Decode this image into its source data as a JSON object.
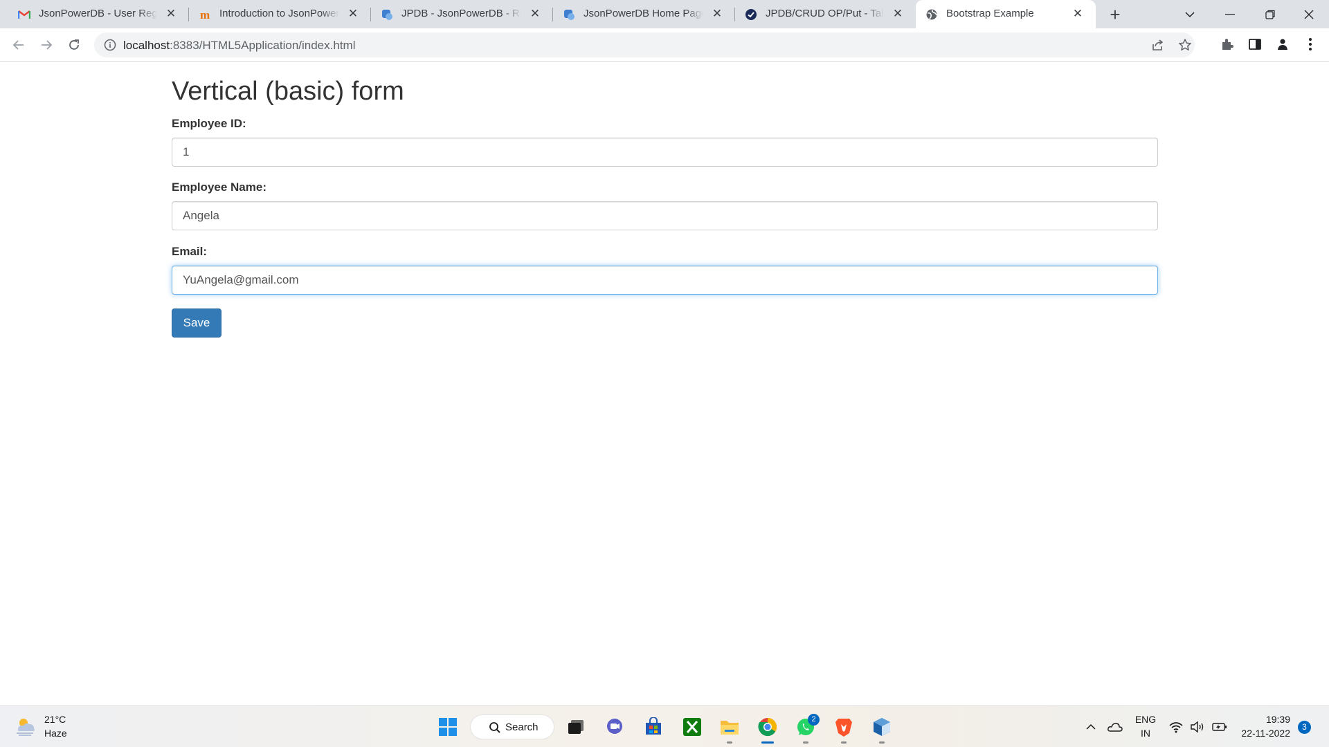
{
  "browser": {
    "tabs": [
      {
        "title": "JsonPowerDB - User Registr",
        "icon": "gmail-icon"
      },
      {
        "title": "Introduction to JsonPowerD",
        "icon": "hashnode-icon"
      },
      {
        "title": "JPDB - JsonPowerDB - REST",
        "icon": "jpdb-icon"
      },
      {
        "title": "JsonPowerDB Home Page",
        "icon": "jpdb-icon"
      },
      {
        "title": "JPDB/CRUD OP/Put - Talent",
        "icon": "check-circle-icon"
      },
      {
        "title": "Bootstrap Example",
        "icon": "globe-icon",
        "active": true
      }
    ],
    "url_host": "localhost",
    "url_path": ":8383/HTML5Application/index.html"
  },
  "form": {
    "heading": "Vertical (basic) form",
    "employee_id_label": "Employee ID:",
    "employee_id_value": "1",
    "employee_name_label": "Employee Name:",
    "employee_name_value": "Angela",
    "email_label": "Email:",
    "email_value": "YuAngela@gmail.com",
    "save_label": "Save"
  },
  "taskbar": {
    "weather_temp": "21°C",
    "weather_desc": "Haze",
    "search_label": "Search",
    "whatsapp_badge": "2",
    "lang_top": "ENG",
    "lang_bottom": "IN",
    "time": "19:39",
    "date": "22-11-2022",
    "notification_count": "3"
  },
  "colors": {
    "primary_button": "#337ab7",
    "focus_border": "#66afe9",
    "tab_strip": "#dee1e6",
    "accent": "#0067c0"
  }
}
